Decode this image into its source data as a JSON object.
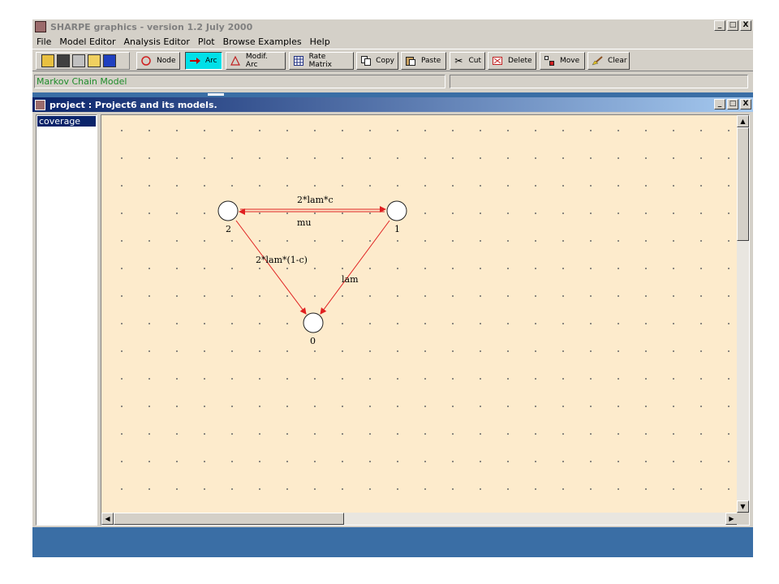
{
  "app": {
    "title": "SHARPE graphics  -  version 1.2  July 2000",
    "window_buttons": [
      "_",
      "□",
      "X"
    ]
  },
  "menu": [
    "File",
    "Model Editor",
    "Analysis Editor",
    "Plot",
    "Browse Examples",
    "Help"
  ],
  "toolbar": {
    "file_icons": [
      "open-folder-icon",
      "save-icon",
      "print-icon",
      "new-folder-icon",
      "book-icon"
    ],
    "buttons": [
      {
        "label": "Node",
        "icon": "circle-icon"
      },
      {
        "label": "Arc",
        "icon": "arrow-icon",
        "active": true
      },
      {
        "label": "Modif. Arc",
        "icon": "triangle-icon"
      },
      {
        "label": "Rate Matrix",
        "icon": "grid-icon"
      },
      {
        "label": "Copy",
        "icon": "copy-icon"
      },
      {
        "label": "Paste",
        "icon": "paste-icon"
      },
      {
        "label": "Cut",
        "icon": "scissors-icon"
      },
      {
        "label": "Delete",
        "icon": "delete-icon"
      },
      {
        "label": "Move",
        "icon": "move-icon"
      },
      {
        "label": "Clear",
        "icon": "broom-icon"
      }
    ]
  },
  "status": {
    "model_type": "Markov Chain Model",
    "right": ""
  },
  "inner_window": {
    "title": "project : Project6 and its models.",
    "tree_items": [
      "coverage"
    ]
  },
  "graph": {
    "nodes": [
      {
        "id": "2",
        "label": "2"
      },
      {
        "id": "1",
        "label": "1"
      },
      {
        "id": "0",
        "label": "0"
      }
    ],
    "arcs": [
      {
        "from": "2",
        "to": "1",
        "label": "2*lam*c"
      },
      {
        "from": "1",
        "to": "2",
        "label": "mu"
      },
      {
        "from": "2",
        "to": "0",
        "label": "2*lam*(1-c)"
      },
      {
        "from": "1",
        "to": "0",
        "label": "lam"
      }
    ],
    "colors": {
      "arc": "#e02020",
      "canvas": "#fdebcc",
      "node_fill": "#ffffff"
    }
  }
}
